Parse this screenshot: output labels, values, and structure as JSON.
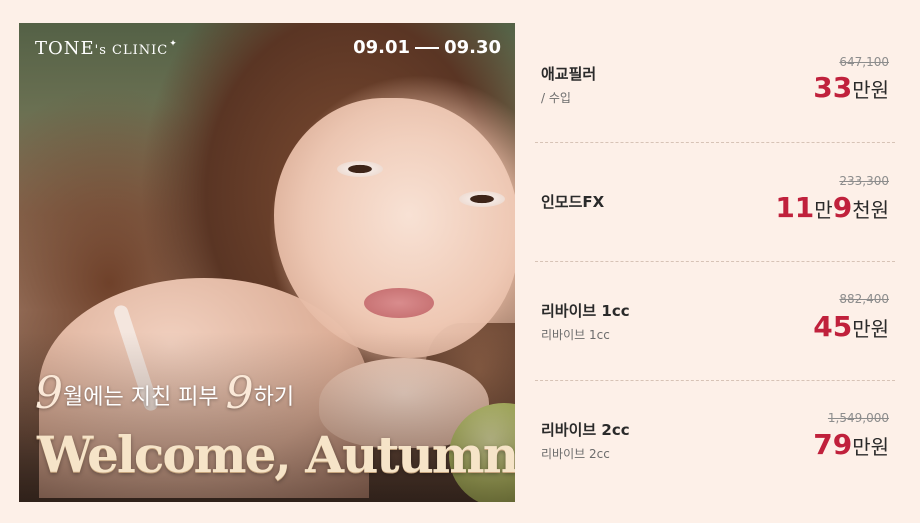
{
  "banner": {
    "brand_prefix": "TONE",
    "brand_suffix": "s CLINIC",
    "brand_mark": "'",
    "brand_star": "✦",
    "date_start": "09.01",
    "date_end": "09.30",
    "headline_big_a": "9",
    "headline_text_a": "월에는 지친 피부 ",
    "headline_big_b": "9",
    "headline_text_b": "하기",
    "welcome": "Welcome, Autumn!"
  },
  "price_list": {
    "items": [
      {
        "name": "애교필러",
        "sub": "/ 수입",
        "orig": "647,100",
        "num1": "33",
        "unit1": "만원",
        "num2": "",
        "unit2": ""
      },
      {
        "name": "인모드FX",
        "sub": "",
        "orig": "233,300",
        "num1": "11",
        "unit1": "만",
        "num2": "9",
        "unit2": "천원"
      },
      {
        "name": "리바이브 1cc",
        "sub": "리바이브 1cc",
        "orig": "882,400",
        "num1": "45",
        "unit1": "만원",
        "num2": "",
        "unit2": ""
      },
      {
        "name": "리바이브 2cc",
        "sub": "리바이브 2cc",
        "orig": "1,549,000",
        "num1": "79",
        "unit1": "만원",
        "num2": "",
        "unit2": ""
      }
    ]
  },
  "colors": {
    "background": "#fdf0e8",
    "price_accent": "#c0213c",
    "text": "#2a2a2a"
  }
}
